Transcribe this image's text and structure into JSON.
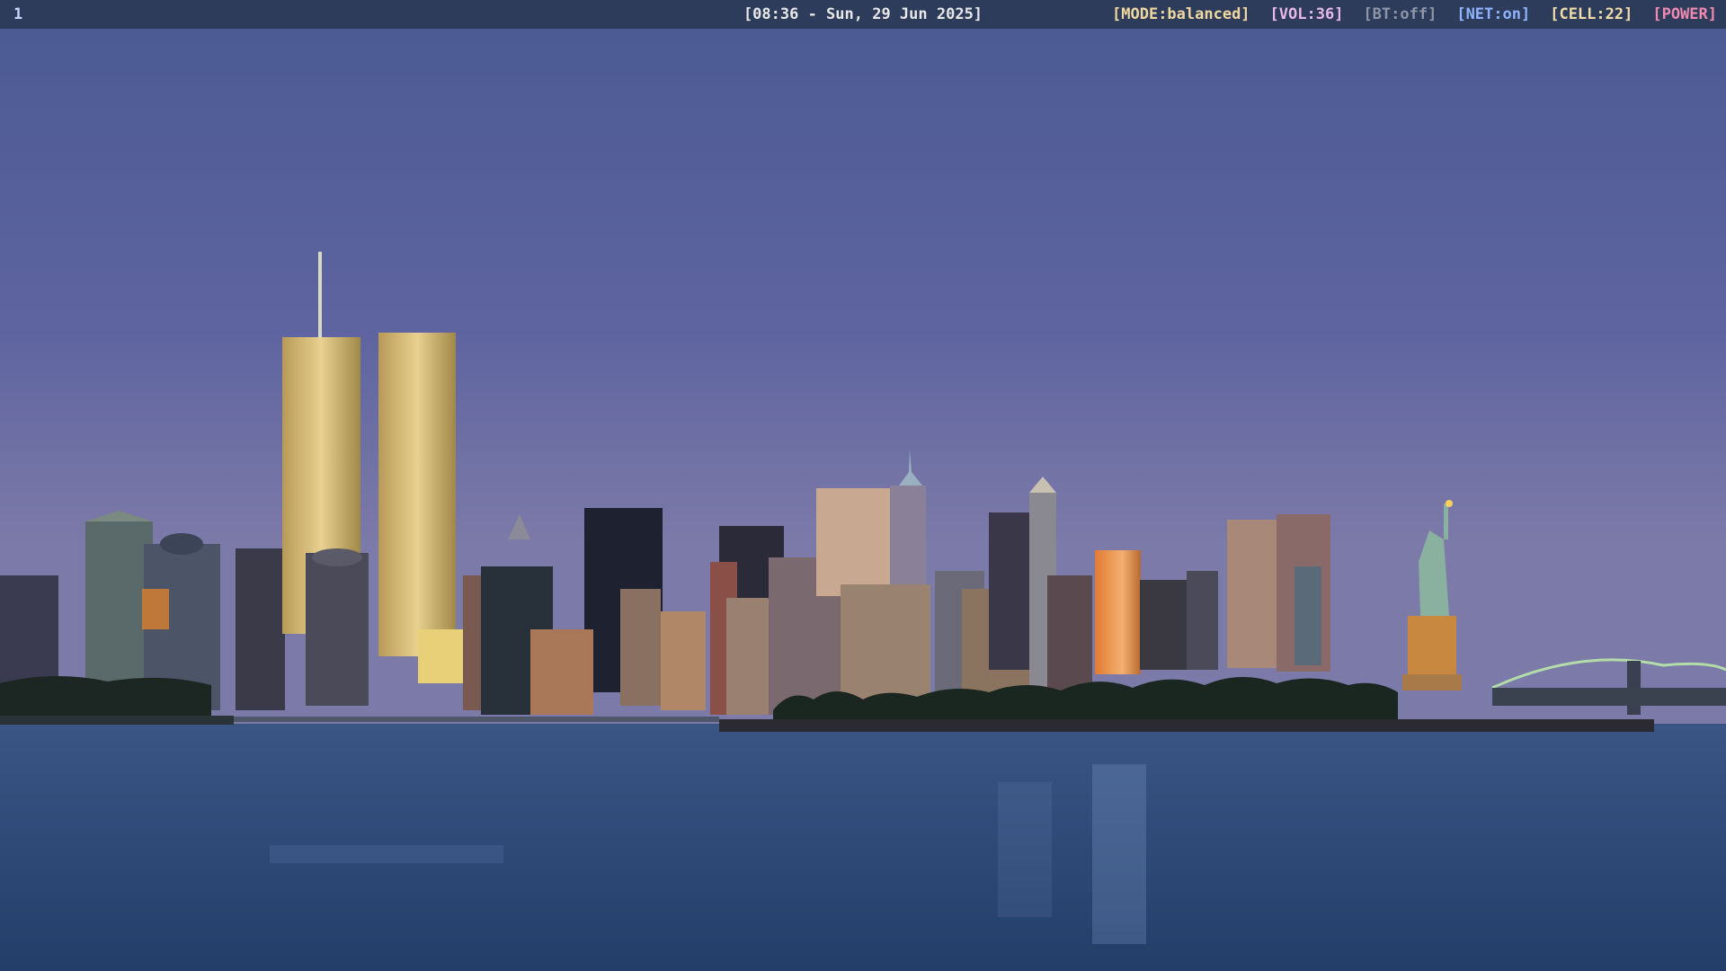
{
  "bar": {
    "workspace": "1",
    "clock": "[08:36 - Sun, 29 Jun 2025]",
    "modules": [
      {
        "key": "mode",
        "text": "[MODE:balanced]",
        "color": "#f0d8a0"
      },
      {
        "key": "vol",
        "text": "[VOL:36]",
        "color": "#e8b8e8"
      },
      {
        "key": "bt",
        "text": "[BT:off]",
        "color": "#8e95a8"
      },
      {
        "key": "net",
        "text": "[NET:on]",
        "color": "#8fb4ff"
      },
      {
        "key": "cell",
        "text": "[CELL:22]",
        "color": "#f0dca8"
      },
      {
        "key": "power",
        "text": "[POWER]",
        "color": "#f08ab0"
      }
    ],
    "colors": {
      "background": "#2d3c5a",
      "workspace": "#c8d4ff",
      "clock": "#e8e8e8"
    }
  },
  "wallpaper": {
    "subject": "night skyline over water with twin towers and statue on an island",
    "colors": {
      "sky_top": "#4a5a90",
      "sky_bottom": "#7a7aa8",
      "water": "#2c4a78"
    }
  }
}
